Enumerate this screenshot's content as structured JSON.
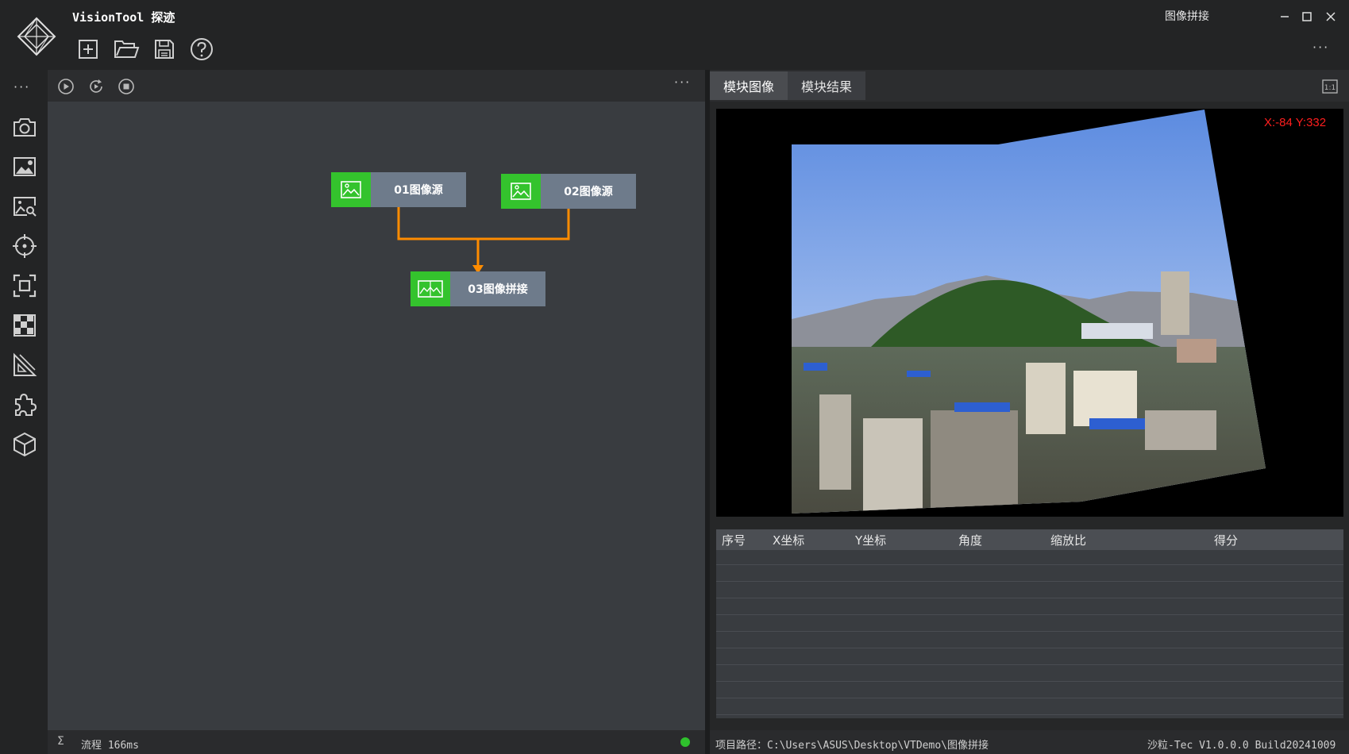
{
  "app": {
    "title": "VisionTool 探迹"
  },
  "window": {
    "title": "图像拼接"
  },
  "toolbar": {
    "icons": [
      "new-icon",
      "open-folder-icon",
      "save-icon",
      "help-icon"
    ]
  },
  "sidebar": {
    "icons": [
      "camera-icon",
      "image-enhance-icon",
      "image-search-icon",
      "target-icon",
      "focus-frame-icon",
      "checkerboard-icon",
      "measure-icon",
      "puzzle-plugin-icon",
      "cube-icon"
    ]
  },
  "flow": {
    "controls": [
      "run-icon",
      "loop-run-icon",
      "stop-icon"
    ],
    "nodes": [
      {
        "label": "01图像源",
        "icon": "image-icon"
      },
      {
        "label": "02图像源",
        "icon": "image-icon"
      },
      {
        "label": "03图像拼接",
        "icon": "stitch-icon"
      }
    ],
    "status": {
      "time": "流程 166ms",
      "indicator_color": "#2fc12d"
    }
  },
  "right_panel": {
    "tabs": [
      "模块图像",
      "模块结果"
    ],
    "ratio_label": "1:1",
    "coord_readout": "X:-84 Y:332",
    "table": {
      "headers": [
        "序号",
        "X坐标",
        "Y坐标",
        "角度",
        "缩放比",
        "得分"
      ],
      "rows": []
    },
    "status": {
      "path": "项目路径：C:\\Users\\ASUS\\Desktop\\VTDemo\\图像拼接",
      "version": "沙粒-Tec V1.0.0.0 Build20241009"
    }
  },
  "colors": {
    "accent_green": "#34c32d",
    "connector_orange": "#ff8c00",
    "node_gray": "#6e7b8b",
    "readout_red": "#ff1e1e"
  }
}
